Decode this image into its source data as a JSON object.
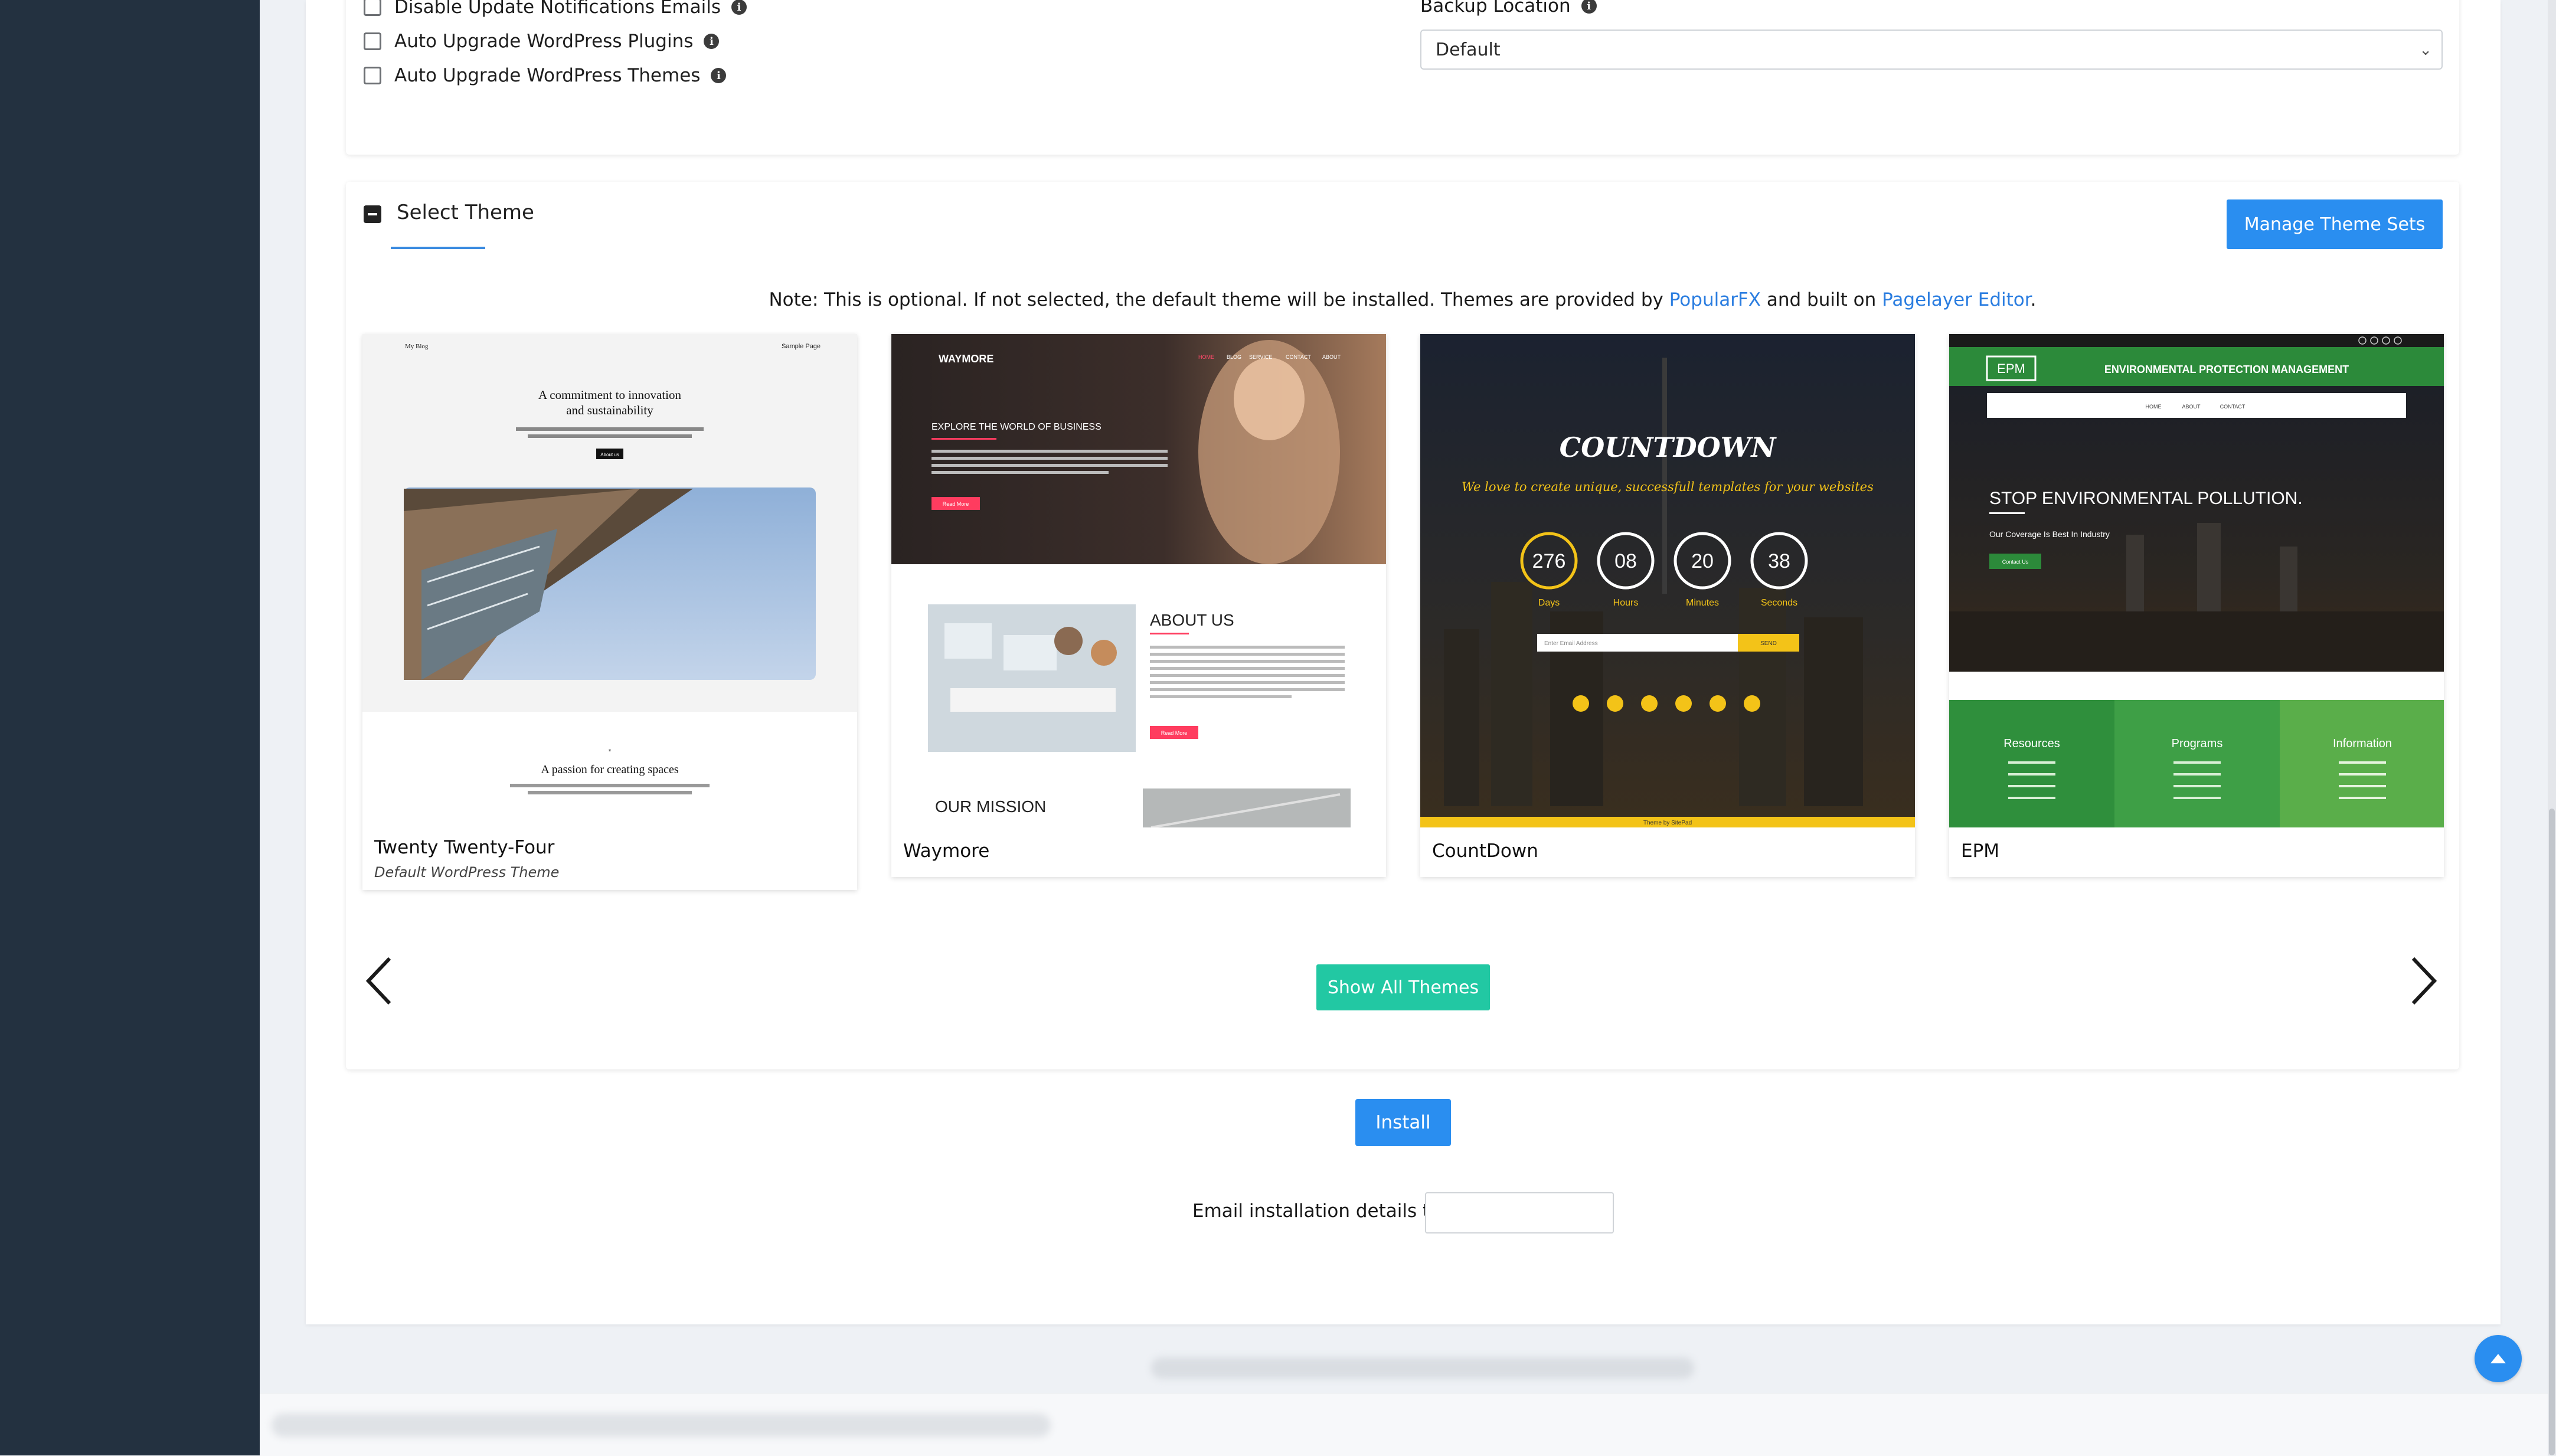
{
  "options": {
    "disable_notifications": "Disable Update Notifications Emails",
    "auto_upgrade_plugins": "Auto Upgrade WordPress Plugins",
    "auto_upgrade_themes": "Auto Upgrade WordPress Themes",
    "backup_location_label": "Backup Location",
    "backup_location_value": "Default"
  },
  "select_theme": {
    "title": "Select Theme",
    "manage_button": "Manage Theme Sets",
    "note_prefix": "Note: This is optional. If not selected, the default theme will be installed. Themes are provided by ",
    "note_link1": "PopularFX",
    "note_mid": " and built on ",
    "note_link2": "Pagelayer Editor",
    "note_suffix": "."
  },
  "themes": [
    {
      "name": "Twenty Twenty-Four",
      "subtitle": "Default WordPress Theme",
      "preview": {
        "brand": "My Blog",
        "nav": "Sample Page",
        "headline1": "A commitment to innovation",
        "headline2": "and sustainability",
        "button": "About us",
        "section": "A passion for creating spaces"
      }
    },
    {
      "name": "Waymore",
      "preview": {
        "brand": "WAYMORE",
        "nav": [
          "HOME",
          "BLOG",
          "SERVICE",
          "CONTACT",
          "ABOUT"
        ],
        "hero": "EXPLORE THE WORLD OF BUSINESS",
        "button": "Read More",
        "about": "ABOUT US",
        "mission": "OUR MISSION"
      }
    },
    {
      "name": "CountDown",
      "preview": {
        "title": "COUNTDOWN",
        "tagline": "We love to create unique, successfull templates for your websites",
        "counters": [
          {
            "value": "276",
            "label": "Days"
          },
          {
            "value": "08",
            "label": "Hours"
          },
          {
            "value": "20",
            "label": "Minutes"
          },
          {
            "value": "38",
            "label": "Seconds"
          }
        ],
        "email_placeholder": "Enter Email Address",
        "send": "SEND",
        "footer": "Theme by SitePad"
      }
    },
    {
      "name": "EPM",
      "preview": {
        "logo": "EPM",
        "heading": "ENVIRONMENTAL PROTECTION MANAGEMENT",
        "nav": [
          "HOME",
          "ABOUT",
          "CONTACT"
        ],
        "hero": "STOP ENVIRONMENTAL POLLUTION.",
        "sub": "Our Coverage Is Best In Industry",
        "button": "Contact Us",
        "columns": [
          "Resources",
          "Programs",
          "Information"
        ]
      }
    }
  ],
  "buttons": {
    "show_all": "Show All Themes",
    "install": "Install"
  },
  "email": {
    "label": "Email installation details to :"
  },
  "icons": {
    "prev": "chevron-left-icon",
    "next": "chevron-right-icon",
    "to_top": "arrow-up-icon"
  }
}
